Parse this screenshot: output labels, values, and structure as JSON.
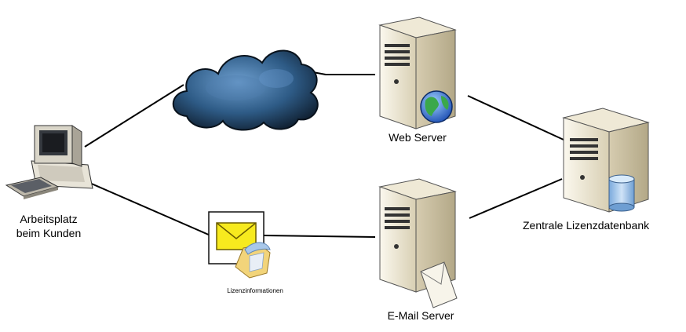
{
  "nodes": {
    "client": {
      "label_line1": "Arbeitsplatz",
      "label_line2": "beim Kunden",
      "icon": "desktop-computer-icon"
    },
    "internet": {
      "icon": "cloud-icon"
    },
    "web_server": {
      "label": "Web Server",
      "icon": "server-globe-icon"
    },
    "mail_server": {
      "label": "E-Mail Server",
      "icon": "server-envelope-icon"
    },
    "license_db": {
      "label": "Zentrale Lizenzdatenbank",
      "icon": "server-database-icon"
    },
    "license_info": {
      "label": "Lizenzinformationen",
      "icon": "mail-document-icon"
    }
  },
  "edges": [
    {
      "from": "client",
      "to": "internet"
    },
    {
      "from": "internet",
      "to": "web_server"
    },
    {
      "from": "web_server",
      "to": "license_db"
    },
    {
      "from": "client",
      "to": "license_info"
    },
    {
      "from": "license_info",
      "to": "mail_server"
    },
    {
      "from": "mail_server",
      "to": "license_db"
    }
  ],
  "colors": {
    "line": "#000000",
    "server_light": "#f4efe0",
    "server_dark": "#c9bfa3",
    "cloud_dark": "#0f2233",
    "cloud_light": "#5c8fc0",
    "envelope": "#f7ea1e",
    "db_cylinder": "#9fc4ea"
  }
}
